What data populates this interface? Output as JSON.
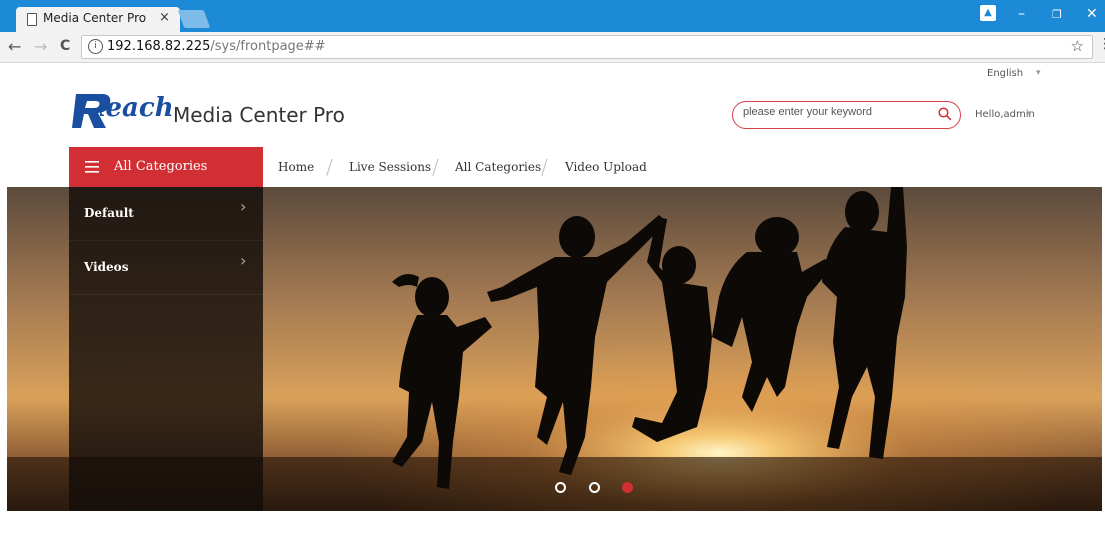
{
  "browser": {
    "tab_title": "Media Center Pro",
    "tab_close": "×",
    "url_host": "192.168.82.225",
    "url_path": "/sys/frontpage##",
    "info_glyph": "i",
    "nav": {
      "back": "←",
      "forward": "→",
      "reload": "C"
    },
    "star": "☆",
    "menu": "⋮",
    "window": {
      "minimize": "–",
      "restore": "❐",
      "close": "✕"
    },
    "colors": {
      "titlebar": "#1c8ad6"
    }
  },
  "header": {
    "language": "English",
    "language_caret": "▾",
    "logo_text": "Reach",
    "brand_suffix": "Media Center Pro",
    "search_placeholder": "please enter your keyword",
    "user_greeting": "Hello,admin",
    "user_caret": "▾"
  },
  "nav": {
    "all_categories": "All Categories",
    "links": [
      "Home",
      "Live Sessions",
      "All Categories",
      "Video Upload"
    ],
    "separator": "/"
  },
  "categories": [
    {
      "label": "Default",
      "chevron": "›"
    },
    {
      "label": "Videos",
      "chevron": "›"
    }
  ],
  "carousel": {
    "total_slides": 3,
    "active_slide": 3
  },
  "colors": {
    "accent": "#d22f35",
    "logo": "#1a4ea0"
  }
}
